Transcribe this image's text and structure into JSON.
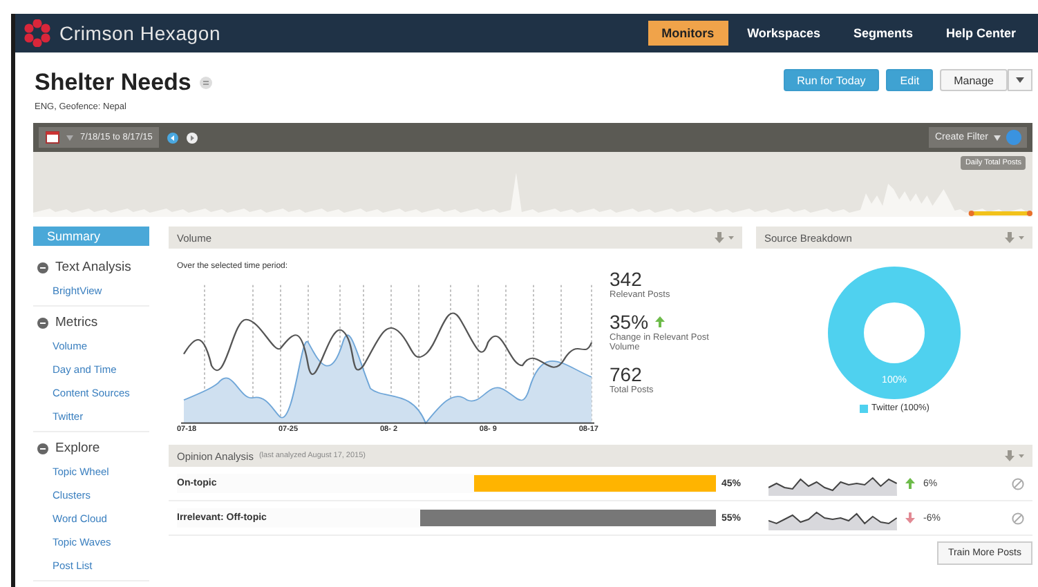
{
  "brand": {
    "name": "Crimson Hexagon"
  },
  "nav": [
    {
      "label": "Monitors",
      "selected": true
    },
    {
      "label": "Workspaces",
      "selected": false
    },
    {
      "label": "Segments",
      "selected": false
    },
    {
      "label": "Help Center",
      "selected": false
    }
  ],
  "monitor": {
    "title": "Shelter Needs",
    "subtitle": "ENG, Geofence: Nepal",
    "actions": [
      {
        "label": "Run for Today",
        "kind": "primary"
      },
      {
        "label": "Edit",
        "kind": "primary"
      },
      {
        "label": "Manage",
        "kind": "split"
      }
    ]
  },
  "filter_bar": {
    "date_range": "7/18/15 to 8/17/15",
    "create_filter": "Create Filter",
    "timeline_label": "Daily Total Posts"
  },
  "sidebar": {
    "items": [
      {
        "label": "Summary",
        "kind": "link",
        "selected": true
      },
      {
        "label": "Text Analysis",
        "kind": "section",
        "expanded": true,
        "children": [
          {
            "label": "BrightView",
            "selected": false
          }
        ]
      },
      {
        "label": "Metrics",
        "kind": "section",
        "expanded": true,
        "children": [
          {
            "label": "Volume",
            "selected": false
          },
          {
            "label": "Day and Time",
            "selected": false
          },
          {
            "label": "Content Sources",
            "selected": false
          },
          {
            "label": "Twitter",
            "selected": false
          }
        ]
      },
      {
        "label": "Explore",
        "kind": "section",
        "expanded": true,
        "children": [
          {
            "label": "Topic Wheel",
            "selected": false
          },
          {
            "label": "Clusters",
            "selected": false
          },
          {
            "label": "Word Cloud",
            "selected": false
          },
          {
            "label": "Topic Waves",
            "selected": false
          },
          {
            "label": "Post List",
            "selected": false
          }
        ]
      }
    ]
  },
  "volume": {
    "title": "Volume",
    "caption": "Over the selected time period:",
    "x_labels": [
      "07-18",
      "07-25",
      "08- 2",
      "08- 9",
      "08-17"
    ],
    "stats": [
      {
        "value": "342",
        "label": "Relevant Posts",
        "kind": "plain"
      },
      {
        "value": "35%",
        "label": "Change in Relevant Post Volume",
        "kind": "change",
        "rising": true
      },
      {
        "value": "762",
        "label": "Total Posts",
        "kind": "plain"
      }
    ]
  },
  "source_breakdown": {
    "title": "Source Breakdown",
    "slice_label": "100%",
    "legend": [
      {
        "label": "Twitter (100%)",
        "color": "#4fd1ef"
      }
    ]
  },
  "opinion": {
    "title": "Opinion Analysis",
    "note": "(last analyzed August 17, 2015)",
    "rows": [
      {
        "label": "On-topic",
        "level": 0.45,
        "percent": "45%",
        "color": "#ffb400",
        "rising": true,
        "change": "6%"
      },
      {
        "label": "Irrelevant: Off-topic",
        "level": 0.55,
        "percent": "55%",
        "color": "#777777",
        "rising": false,
        "change": "-6%"
      }
    ],
    "button": "Train More Posts"
  }
}
